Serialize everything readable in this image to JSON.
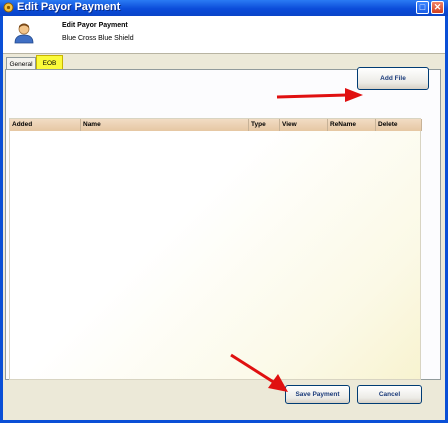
{
  "window": {
    "title": "Edit Payor Payment",
    "maximize_icon": "maximize-icon",
    "close_icon": "close-icon"
  },
  "header": {
    "title": "Edit Payor Payment",
    "subtitle": "Blue Cross Blue Shield",
    "icon": "user-icon"
  },
  "tabs": [
    {
      "label": "General"
    },
    {
      "label": "EOB",
      "selected": true
    }
  ],
  "eob": {
    "add_file_label": "Add File",
    "columns": [
      "Added",
      "Name",
      "Type",
      "View",
      "ReName",
      "Delete"
    ]
  },
  "footer": {
    "save_label": "Save Payment",
    "cancel_label": "Cancel"
  },
  "colors": {
    "title_bar": "#0b4cd9",
    "highlight": "#fbfb3a",
    "arrow": "#e01010"
  }
}
